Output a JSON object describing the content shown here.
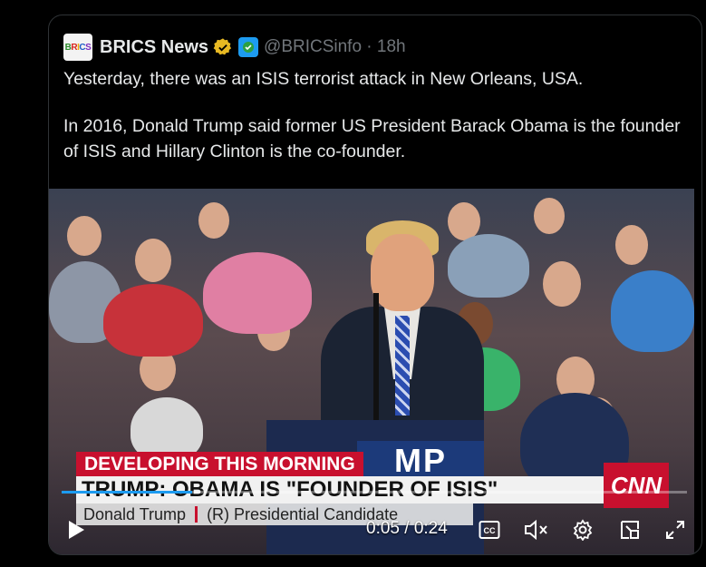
{
  "tweet": {
    "avatar_text": "BRICS",
    "display_name": "BRICS News",
    "handle_time": "@BRICSinfo · 18h",
    "paragraphs": [
      "Yesterday, there was an ISIS terrorist attack in New Orleans, USA.",
      "In 2016, Donald Trump said former US President Barack Obama is the founder of ISIS and Hillary Clinton is the co-founder."
    ],
    "icons": [
      "verified-badge-icon",
      "affiliate-badge-icon"
    ]
  },
  "video": {
    "banner": "DEVELOPING THIS MORNING",
    "headline": "TRUMP: OBAMA IS \"FOUNDER OF ISIS\"",
    "speaker_name": "Donald Trump",
    "speaker_role": "(R) Presidential Candidate",
    "podium_text": "MP",
    "network": "CNN",
    "time_display": "0:05 / 0:24",
    "progress_fraction": 0.208,
    "controls": [
      "play-icon",
      "captions-icon",
      "mute-icon",
      "settings-icon",
      "pip-icon",
      "fullscreen-icon"
    ],
    "colors": {
      "accent": "#1d9bf0",
      "cnn_red": "#c8102e"
    }
  }
}
